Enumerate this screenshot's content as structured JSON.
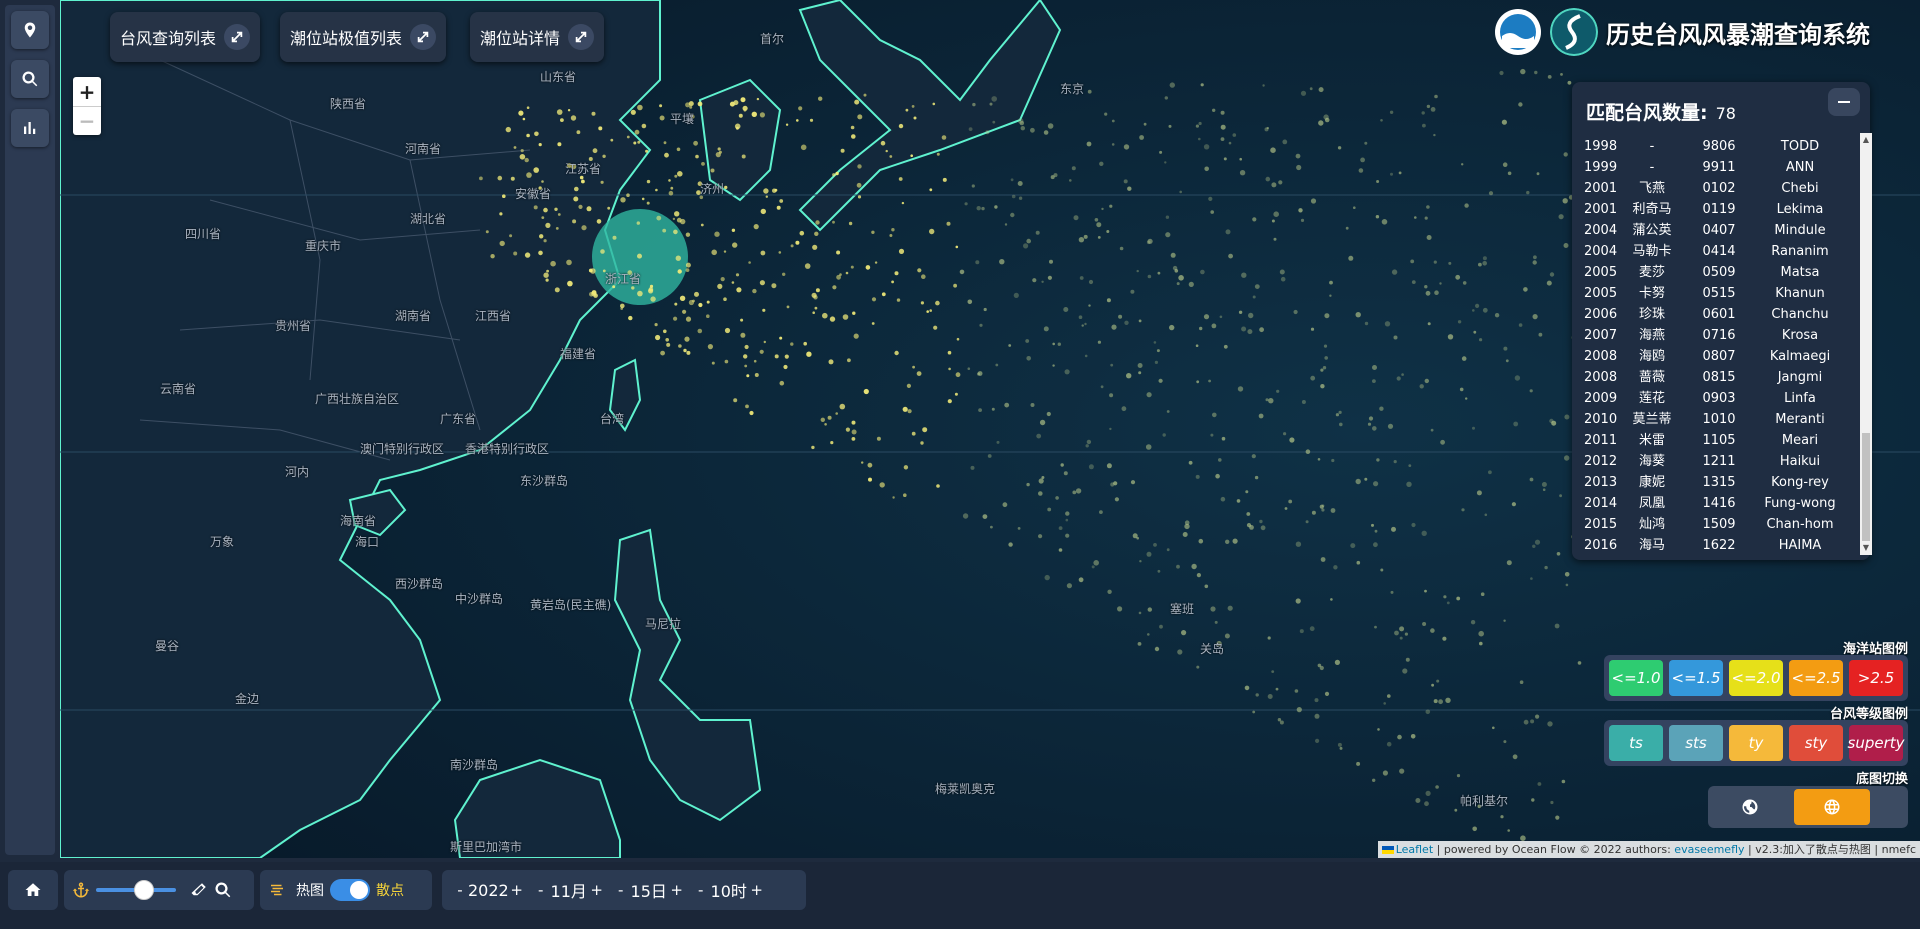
{
  "toolbar": {
    "btn_typhoon_list": "台风查询列表",
    "btn_tide_extreme_list": "潮位站极值列表",
    "btn_tide_detail": "潮位站详情"
  },
  "zoom": {
    "in": "+",
    "out": "−"
  },
  "header": {
    "title": "历史台风风暴潮查询系统"
  },
  "typhoon_panel": {
    "label": "匹配台风数量:",
    "count": "78",
    "rows": [
      [
        "1998",
        "-",
        "9806",
        "TODD"
      ],
      [
        "1999",
        "-",
        "9911",
        "ANN"
      ],
      [
        "2001",
        "飞燕",
        "0102",
        "Chebi"
      ],
      [
        "2001",
        "利奇马",
        "0119",
        "Lekima"
      ],
      [
        "2004",
        "蒲公英",
        "0407",
        "Mindule"
      ],
      [
        "2004",
        "马勒卡",
        "0414",
        "Rananim"
      ],
      [
        "2005",
        "麦莎",
        "0509",
        "Matsa"
      ],
      [
        "2005",
        "卡努",
        "0515",
        "Khanun"
      ],
      [
        "2006",
        "珍珠",
        "0601",
        "Chanchu"
      ],
      [
        "2007",
        "海燕",
        "0716",
        "Krosa"
      ],
      [
        "2008",
        "海鸥",
        "0807",
        "Kalmaegi"
      ],
      [
        "2008",
        "蔷薇",
        "0815",
        "Jangmi"
      ],
      [
        "2009",
        "莲花",
        "0903",
        "Linfa"
      ],
      [
        "2010",
        "莫兰蒂",
        "1010",
        "Meranti"
      ],
      [
        "2011",
        "米雷",
        "1105",
        "Meari"
      ],
      [
        "2012",
        "海葵",
        "1211",
        "Haikui"
      ],
      [
        "2013",
        "康妮",
        "1315",
        "Kong-rey"
      ],
      [
        "2014",
        "凤凰",
        "1416",
        "Fung-wong"
      ],
      [
        "2015",
        "灿鸿",
        "1509",
        "Chan-hom"
      ],
      [
        "2016",
        "海马",
        "1622",
        "HAIMA"
      ]
    ]
  },
  "ocean_legend": {
    "title": "海洋站图例",
    "items": [
      {
        "label": "<=1.0",
        "color": "#2ecc71"
      },
      {
        "label": "<=1.5",
        "color": "#3498db"
      },
      {
        "label": "<=2.0",
        "color": "#e6e019"
      },
      {
        "label": "<=2.5",
        "color": "#f39c12"
      },
      {
        "label": ">2.5",
        "color": "#e52222"
      }
    ]
  },
  "typhoon_legend": {
    "title": "台风等级图例",
    "items": [
      {
        "label": "ts",
        "color": "#3aaea8"
      },
      {
        "label": "sts",
        "color": "#5ba3b8"
      },
      {
        "label": "ty",
        "color": "#f5b93a"
      },
      {
        "label": "sty",
        "color": "#e04d3a"
      },
      {
        "label": "superty",
        "color": "#b01e4a"
      }
    ]
  },
  "basemap": {
    "title": "底图切换",
    "options": [
      {
        "icon": "globe-dark-icon",
        "active": false
      },
      {
        "icon": "globe-light-icon",
        "active": true
      }
    ]
  },
  "map_labels": [
    "山东省",
    "陕西省",
    "河南省",
    "江苏省",
    "安徽省",
    "四川省",
    "湖北省",
    "重庆市",
    "湖南省",
    "江西省",
    "贵州省",
    "浙江省",
    "福建省",
    "云南省",
    "广西壮族自治区",
    "广东省",
    "澳门特别行政区",
    "香港特别行政区",
    "东沙群岛",
    "台湾",
    "河内",
    "海南省",
    "海口",
    "西沙群岛",
    "中沙群岛",
    "黄岩岛(民主礁)",
    "马尼拉",
    "万象",
    "曼谷",
    "金边",
    "南沙群岛",
    "斯里巴加湾市",
    "梅莱凯奥克",
    "帕利基尔",
    "塞班",
    "关岛",
    "东京",
    "首尔",
    "平壤",
    "济州"
  ],
  "attribution": {
    "leaflet": "Leaflet",
    "text1": " | powered by Ocean Flow © 2022 authors: ",
    "author": "evaseemefly",
    "text2": " | v2.3:加入了散点与热图 | nmefc"
  },
  "bottom_bar": {
    "heatmap_label": "热图",
    "scatter_label": "散点",
    "slider_value": 0.6,
    "toggle_on": true,
    "year": "2022",
    "month": "11月",
    "day": "15日",
    "hour": "10时",
    "minus": "-",
    "plus": "+"
  }
}
